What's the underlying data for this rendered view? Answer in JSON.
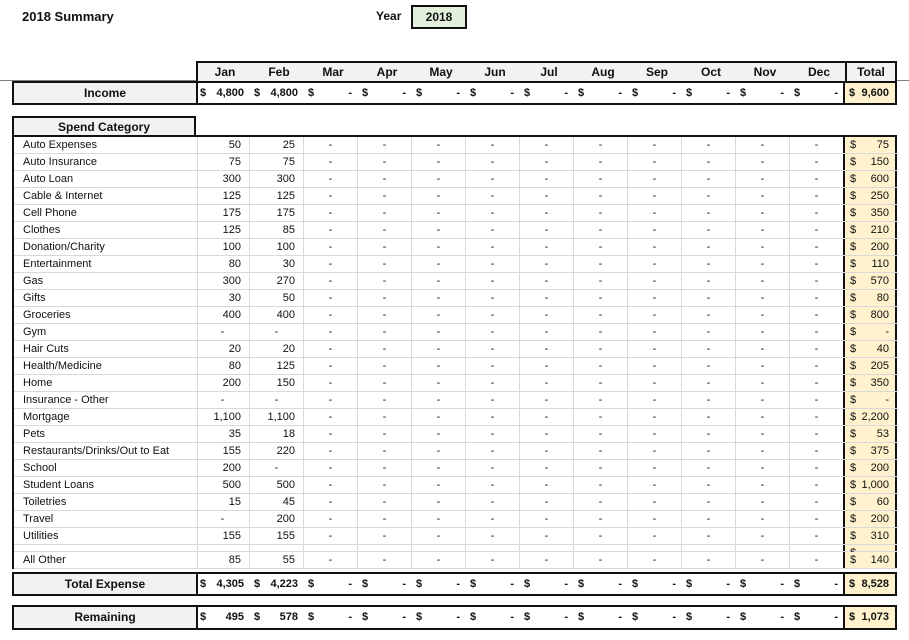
{
  "title": "2018 Summary",
  "year": {
    "label": "Year",
    "value": "2018"
  },
  "months": [
    "Jan",
    "Feb",
    "Mar",
    "Apr",
    "May",
    "Jun",
    "Jul",
    "Aug",
    "Sep",
    "Oct",
    "Nov",
    "Dec"
  ],
  "total_header": "Total",
  "currency": "$",
  "income": {
    "label": "Income",
    "values": [
      "4,800",
      "4,800",
      "-",
      "-",
      "-",
      "-",
      "-",
      "-",
      "-",
      "-",
      "-",
      "-"
    ],
    "total": "9,600"
  },
  "spend_header": "Spend Category",
  "categories": [
    {
      "name": "Auto Expenses",
      "jan": "50",
      "feb": "25",
      "total": "75"
    },
    {
      "name": "Auto Insurance",
      "jan": "75",
      "feb": "75",
      "total": "150"
    },
    {
      "name": "Auto Loan",
      "jan": "300",
      "feb": "300",
      "total": "600"
    },
    {
      "name": "Cable & Internet",
      "jan": "125",
      "feb": "125",
      "total": "250"
    },
    {
      "name": "Cell Phone",
      "jan": "175",
      "feb": "175",
      "total": "350"
    },
    {
      "name": "Clothes",
      "jan": "125",
      "feb": "85",
      "total": "210"
    },
    {
      "name": "Donation/Charity",
      "jan": "100",
      "feb": "100",
      "total": "200"
    },
    {
      "name": "Entertainment",
      "jan": "80",
      "feb": "30",
      "total": "110"
    },
    {
      "name": "Gas",
      "jan": "300",
      "feb": "270",
      "total": "570"
    },
    {
      "name": "Gifts",
      "jan": "30",
      "feb": "50",
      "total": "80"
    },
    {
      "name": "Groceries",
      "jan": "400",
      "feb": "400",
      "total": "800"
    },
    {
      "name": "Gym",
      "jan": "-",
      "feb": "-",
      "total": "-"
    },
    {
      "name": "Hair Cuts",
      "jan": "20",
      "feb": "20",
      "total": "40"
    },
    {
      "name": "Health/Medicine",
      "jan": "80",
      "feb": "125",
      "total": "205"
    },
    {
      "name": "Home",
      "jan": "200",
      "feb": "150",
      "total": "350"
    },
    {
      "name": "Insurance - Other",
      "jan": "-",
      "feb": "-",
      "total": "-"
    },
    {
      "name": "Mortgage",
      "jan": "1,100",
      "feb": "1,100",
      "total": "2,200"
    },
    {
      "name": "Pets",
      "jan": "35",
      "feb": "18",
      "total": "53"
    },
    {
      "name": "Restaurants/Drinks/Out to Eat",
      "jan": "155",
      "feb": "220",
      "total": "375"
    },
    {
      "name": "School",
      "jan": "200",
      "feb": "-",
      "total": "200"
    },
    {
      "name": "Student Loans",
      "jan": "500",
      "feb": "500",
      "total": "1,000"
    },
    {
      "name": "Toiletries",
      "jan": "15",
      "feb": "45",
      "total": "60"
    },
    {
      "name": "Travel",
      "jan": "-",
      "feb": "200",
      "total": "200"
    },
    {
      "name": "Utilities",
      "jan": "155",
      "feb": "155",
      "total": "310"
    },
    {
      "name": "",
      "jan": "",
      "feb": "",
      "total": "-",
      "spacer": true
    },
    {
      "name": "All Other",
      "jan": "85",
      "feb": "55",
      "total": "140"
    }
  ],
  "other_month_value": "-",
  "total_expense": {
    "label": "Total Expense",
    "values": [
      "4,305",
      "4,223",
      "-",
      "-",
      "-",
      "-",
      "-",
      "-",
      "-",
      "-",
      "-",
      "-"
    ],
    "total": "8,528"
  },
  "remaining": {
    "label": "Remaining",
    "values": [
      "495",
      "578",
      "-",
      "-",
      "-",
      "-",
      "-",
      "-",
      "-",
      "-",
      "-",
      "-"
    ],
    "total": "1,073"
  }
}
